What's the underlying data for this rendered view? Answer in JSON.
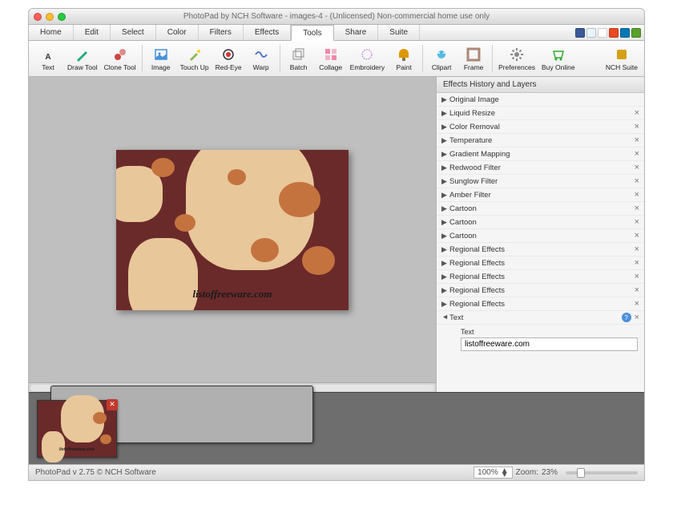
{
  "window": {
    "title": "PhotoPad by NCH Software - images-4 - (Unlicensed) Non-commercial home use only"
  },
  "menu": {
    "items": [
      "Home",
      "Edit",
      "Select",
      "Color",
      "Filters",
      "Effects",
      "Tools",
      "Share",
      "Suite"
    ],
    "active": "Tools"
  },
  "social": [
    {
      "name": "facebook",
      "color": "#3b5998"
    },
    {
      "name": "twitter",
      "color": "#e8f4fb"
    },
    {
      "name": "google",
      "color": "#fff"
    },
    {
      "name": "stumble",
      "color": "#eb4924"
    },
    {
      "name": "linkedin",
      "color": "#0077b5"
    },
    {
      "name": "share",
      "color": "#5aa02c"
    }
  ],
  "toolbar": {
    "groups": [
      [
        {
          "id": "text",
          "label": "Text"
        },
        {
          "id": "draw",
          "label": "Draw Tool"
        },
        {
          "id": "clone",
          "label": "Clone Tool"
        }
      ],
      [
        {
          "id": "image",
          "label": "Image"
        },
        {
          "id": "touchup",
          "label": "Touch Up"
        },
        {
          "id": "redeye",
          "label": "Red-Eye"
        },
        {
          "id": "warp",
          "label": "Warp"
        }
      ],
      [
        {
          "id": "batch",
          "label": "Batch"
        },
        {
          "id": "collage",
          "label": "Collage"
        },
        {
          "id": "embroidery",
          "label": "Embroidery"
        },
        {
          "id": "paint",
          "label": "Paint"
        }
      ],
      [
        {
          "id": "clipart",
          "label": "Clipart"
        },
        {
          "id": "frame",
          "label": "Frame"
        }
      ],
      [
        {
          "id": "prefs",
          "label": "Preferences"
        },
        {
          "id": "buy",
          "label": "Buy Online"
        }
      ]
    ],
    "right": {
      "id": "suite",
      "label": "NCH Suite"
    }
  },
  "canvas": {
    "watermark": "listoffreeware.com"
  },
  "panel": {
    "title": "Effects History and Layers",
    "layers": [
      {
        "name": "Original Image",
        "closable": false
      },
      {
        "name": "Liquid Resize",
        "closable": true
      },
      {
        "name": "Color Removal",
        "closable": true
      },
      {
        "name": "Temperature",
        "closable": true
      },
      {
        "name": "Gradient Mapping",
        "closable": true
      },
      {
        "name": "Redwood Filter",
        "closable": true
      },
      {
        "name": "Sunglow Filter",
        "closable": true
      },
      {
        "name": "Amber Filter",
        "closable": true
      },
      {
        "name": "Cartoon",
        "closable": true
      },
      {
        "name": "Cartoon",
        "closable": true
      },
      {
        "name": "Cartoon",
        "closable": true
      },
      {
        "name": "Regional Effects",
        "closable": true
      },
      {
        "name": "Regional Effects",
        "closable": true
      },
      {
        "name": "Regional Effects",
        "closable": true
      },
      {
        "name": "Regional Effects",
        "closable": true
      },
      {
        "name": "Regional Effects",
        "closable": true
      },
      {
        "name": "Text",
        "closable": true,
        "active": true
      }
    ],
    "text_section": {
      "label": "Text",
      "value": "listoffreeware.com"
    }
  },
  "status": {
    "version": "PhotoPad v 2.75 © NCH Software",
    "zoom_pct": "100%",
    "zoom_label": "Zoom:",
    "zoom_value": "23%"
  }
}
